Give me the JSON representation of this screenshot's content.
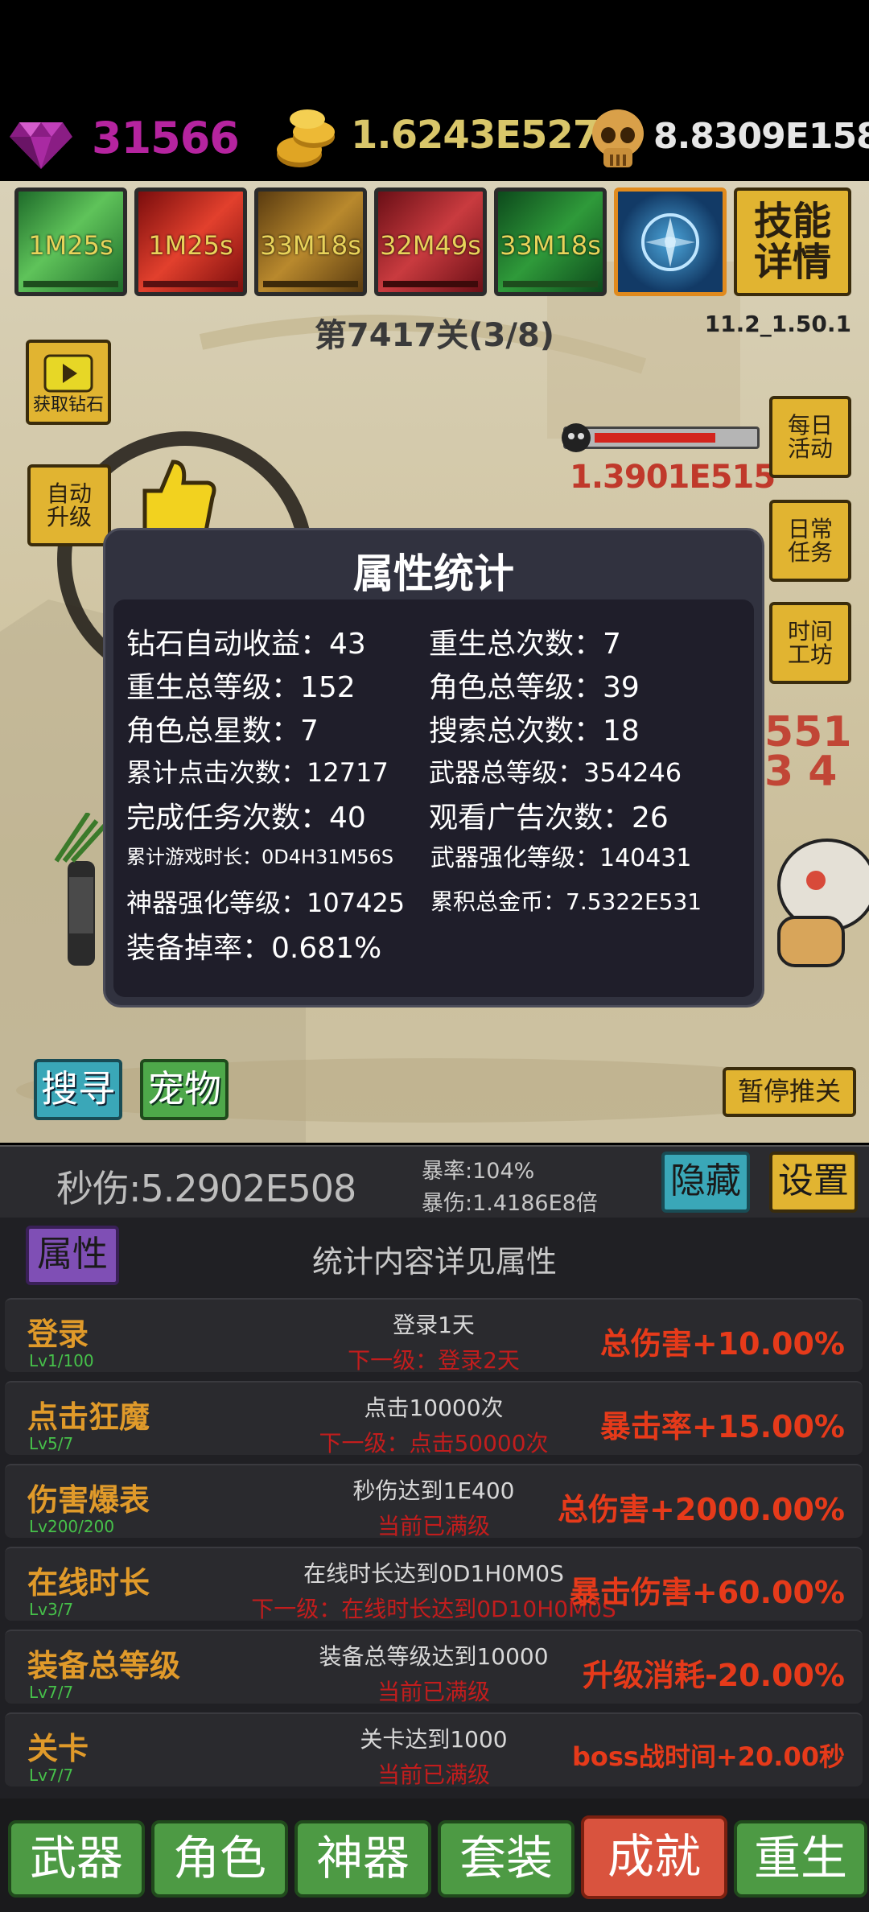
{
  "currency": {
    "diamonds": "31566",
    "gold": "1.6243E527",
    "skulls": "8.8309E158"
  },
  "skills": [
    {
      "icon": "green-speed-skill-icon",
      "timer": "1M25s"
    },
    {
      "icon": "red-warrior-skill-icon",
      "timer": "1M25s"
    },
    {
      "icon": "star-skill-icon",
      "timer": "33M18s"
    },
    {
      "icon": "red-silhouette-skill-icon",
      "timer": "32M49s"
    },
    {
      "icon": "bow-arrow-skill-icon",
      "timer": "33M18s"
    },
    {
      "icon": "blue-shield-skill-icon",
      "timer": ""
    }
  ],
  "skill_details_button": "技能详情",
  "stage_label": "第7417关(3/8)",
  "version": "11.2_1.50.1",
  "side_buttons": {
    "get_diamonds": "获取钻石",
    "auto_upgrade": "自动升级",
    "daily_event": "每日活动",
    "daily_tasks": "日常任务",
    "time_workshop": "时间工坊",
    "search": "搜寻",
    "pet": "宠物",
    "pause_push": "暂停推关"
  },
  "boss_hp": "1.3901E515",
  "damage_numbers": "5513 4",
  "modal": {
    "title": "属性统计",
    "stats": [
      {
        "text": "钻石自动收益：43"
      },
      {
        "text": "重生总次数：7"
      },
      {
        "text": "重生总等级：152"
      },
      {
        "text": "角色总等级：39"
      },
      {
        "text": "角色总星数：7"
      },
      {
        "text": "搜索总次数：18"
      },
      {
        "text": "累计点击次数：12717"
      },
      {
        "text": "武器总等级：354246"
      },
      {
        "text": "完成任务次数：40"
      },
      {
        "text": "观看广告次数：26"
      },
      {
        "text": "累计游戏时长：0D4H31M56S"
      },
      {
        "text": "武器强化等级：140431"
      },
      {
        "text": "神器强化等级：107425"
      },
      {
        "text": "累积总金币：7.5322E531"
      },
      {
        "text": "装备掉率：0.681%"
      }
    ]
  },
  "dps": "秒伤:5.2902E508",
  "crit_rate": "暴率:104%",
  "crit_damage": "暴伤:1.4186E8倍",
  "hide_button": "隐藏",
  "settings_button": "设置",
  "attributes_tab": "属性",
  "panel_subtitle": "统计内容详见属性",
  "achievements": [
    {
      "title": "登录",
      "level": "Lv1/100",
      "desc": "登录1天",
      "next": "下一级：登录2天",
      "bonus": "总伤害+10.00%"
    },
    {
      "title": "点击狂魔",
      "level": "Lv5/7",
      "desc": "点击10000次",
      "next": "下一级：点击50000次",
      "bonus": "暴击率+15.00%"
    },
    {
      "title": "伤害爆表",
      "level": "Lv200/200",
      "desc": "秒伤达到1E400",
      "next": "当前已满级",
      "bonus": "总伤害+2000.00%"
    },
    {
      "title": "在线时长",
      "level": "Lv3/7",
      "desc": "在线时长达到0D1H0M0S",
      "next": "下一级：在线时长达到0D10H0M0S",
      "bonus": "暴击伤害+60.00%"
    },
    {
      "title": "装备总等级",
      "level": "Lv7/7",
      "desc": "装备总等级达到10000",
      "next": "当前已满级",
      "bonus": "升级消耗-20.00%"
    },
    {
      "title": "关卡",
      "level": "Lv7/7",
      "desc": "关卡达到1000",
      "next": "当前已满级",
      "bonus": "boss战时间+20.00秒"
    }
  ],
  "nav": [
    "武器",
    "角色",
    "神器",
    "套装",
    "成就",
    "重生"
  ],
  "colors": {
    "diamond": "#b5249f",
    "gold_text": "#d9c66a",
    "skull_text": "#e6e6e6",
    "nav_green": "#4d9a44",
    "nav_active": "#d9533e",
    "bonus_red": "#e63a1a",
    "title_orange": "#e09a2a"
  }
}
